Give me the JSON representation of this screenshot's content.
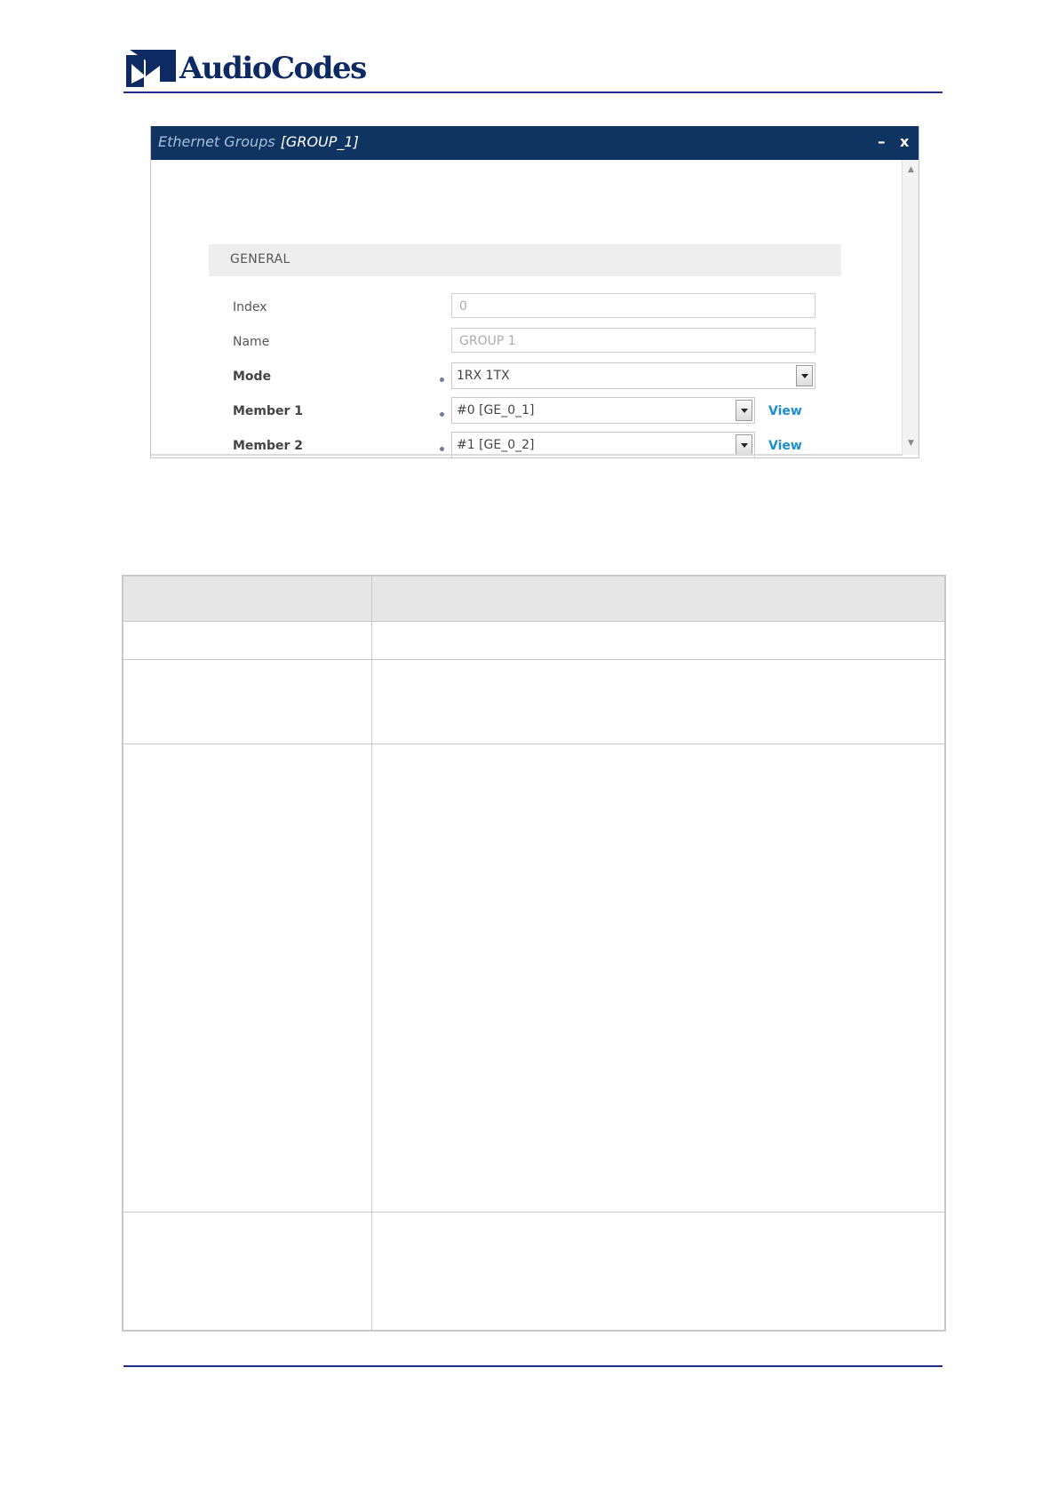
{
  "header": {
    "logo_text": "AudioCodes"
  },
  "dialog": {
    "title": "Ethernet Groups",
    "subtitle": "[GROUP_1]",
    "minimize_label": "–",
    "close_label": "x",
    "section_title": "GENERAL",
    "fields": {
      "index": {
        "label": "Index",
        "value": "0"
      },
      "name": {
        "label": "Name",
        "value": "GROUP 1"
      },
      "mode": {
        "label": "Mode",
        "value": "1RX 1TX"
      },
      "member1": {
        "label": "Member 1",
        "value": "#0 [GE_0_1]",
        "link": "View"
      },
      "member2": {
        "label": "Member 2",
        "value": "#1 [GE_0_2]",
        "link": "View"
      }
    }
  },
  "colors": {
    "title_bar": "#0f3461",
    "link": "#1b8fd2",
    "rule": "#1d2e8c"
  }
}
